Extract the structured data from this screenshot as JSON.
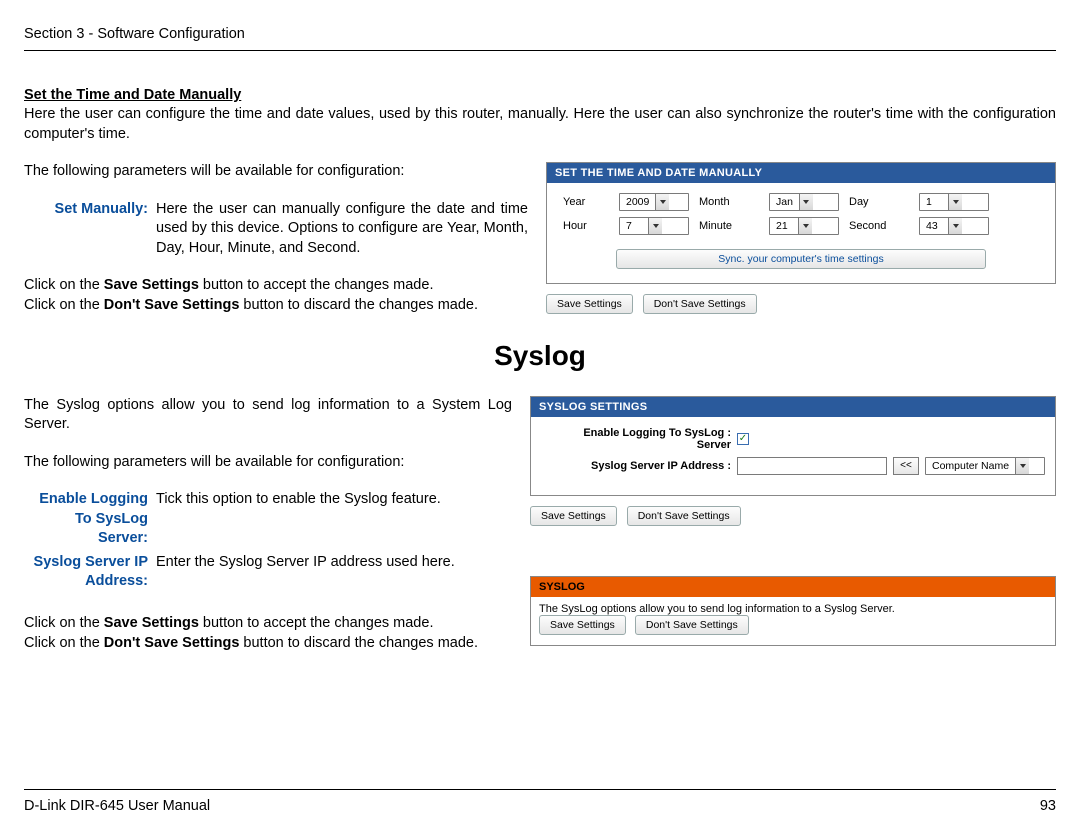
{
  "header": {
    "section": "Section 3 - Software Configuration"
  },
  "s1": {
    "heading": "Set the Time and Date Manually",
    "intro": "Here the user can configure the time and date values, used by this router, manually. Here the user can also synchronize the router's time with the configuration computer's time.",
    "params_intro": "The following parameters will be available for configuration:",
    "label1": "Set Manually:",
    "desc1": "Here the user can manually configure the date and time used by this device. Options to configure are Year, Month, Day, Hour, Minute, and Second.",
    "save_line_pre": "Click on the ",
    "save_bold": "Save Settings",
    "save_line_post": " button to accept the changes made.",
    "dont_line_pre": "Click on the ",
    "dont_bold": "Don't Save Settings",
    "dont_line_post": " button to discard the changes made."
  },
  "panel1": {
    "title": "SET THE TIME AND DATE MANUALLY",
    "labels": {
      "year": "Year",
      "month": "Month",
      "day": "Day",
      "hour": "Hour",
      "minute": "Minute",
      "second": "Second"
    },
    "values": {
      "year": "2009",
      "month": "Jan",
      "day": "1",
      "hour": "7",
      "minute": "21",
      "second": "43"
    },
    "sync_btn": "Sync. your computer's time settings",
    "save": "Save Settings",
    "dont": "Don't Save Settings"
  },
  "s2": {
    "title": "Syslog",
    "intro": "The Syslog options allow you to send log information to a System Log Server.",
    "params_intro": "The following parameters will be available for configuration:",
    "label1": "Enable Logging To SysLog Server:",
    "desc1": "Tick this option to enable the Syslog feature.",
    "label2": "Syslog Server IP Address:",
    "desc2": "Enter the Syslog Server IP address used here.",
    "save_line_pre": "Click on the ",
    "save_bold": "Save Settings",
    "save_line_post": " button to accept the changes made.",
    "dont_line_pre": "Click on the ",
    "dont_bold": "Don't Save Settings",
    "dont_line_post": " button to discard the changes made."
  },
  "panel2": {
    "title": "SYSLOG SETTINGS",
    "row1": "Enable Logging To SysLog  :",
    "row1b": "Server",
    "row2": "Syslog Server IP Address  :",
    "check": "✓",
    "pick": "<<",
    "dropdown": "Computer Name",
    "save": "Save Settings",
    "dont": "Don't Save Settings"
  },
  "panel3": {
    "title": "SYSLOG",
    "note": "The SysLog options allow you to send log information to a Syslog Server.",
    "save": "Save Settings",
    "dont": "Don't Save Settings"
  },
  "footer": {
    "manual": "D-Link DIR-645 User Manual",
    "page": "93"
  }
}
